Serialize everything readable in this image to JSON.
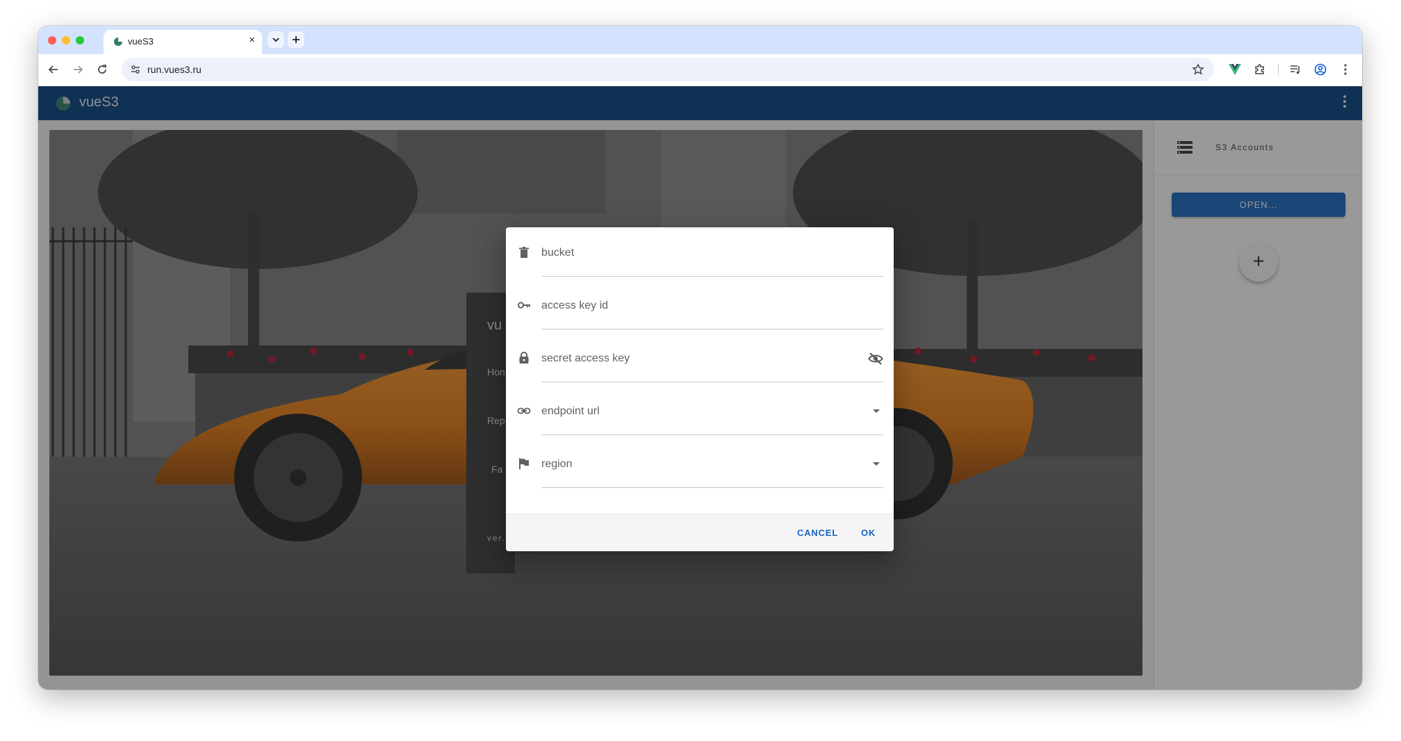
{
  "browser": {
    "tab_title": "vueS3",
    "tab_close": "×",
    "url": "run.vues3.ru"
  },
  "app": {
    "title": "vueS3"
  },
  "sidebar": {
    "title": "S3 Accounts",
    "open_button": "OPEN...",
    "add_button": "+"
  },
  "background_card": {
    "title_fragment": "vu",
    "items": [
      "Hon",
      "Rep",
      "Fa",
      "ver."
    ]
  },
  "dialog": {
    "fields": [
      {
        "label": "bucket",
        "icon": "trash-icon"
      },
      {
        "label": "access key id",
        "icon": "key-icon"
      },
      {
        "label": "secret access key",
        "icon": "lock-icon",
        "right_icon": "eye-off-icon"
      },
      {
        "label": "endpoint url",
        "icon": "link-icon",
        "dropdown": true
      },
      {
        "label": "region",
        "icon": "flag-icon",
        "dropdown": true
      }
    ],
    "cancel_label": "CANCEL",
    "ok_label": "OK"
  },
  "colors": {
    "app_bar": "#003f7f",
    "accent": "#1565c0",
    "tab_strip": "#d3e3fd"
  }
}
